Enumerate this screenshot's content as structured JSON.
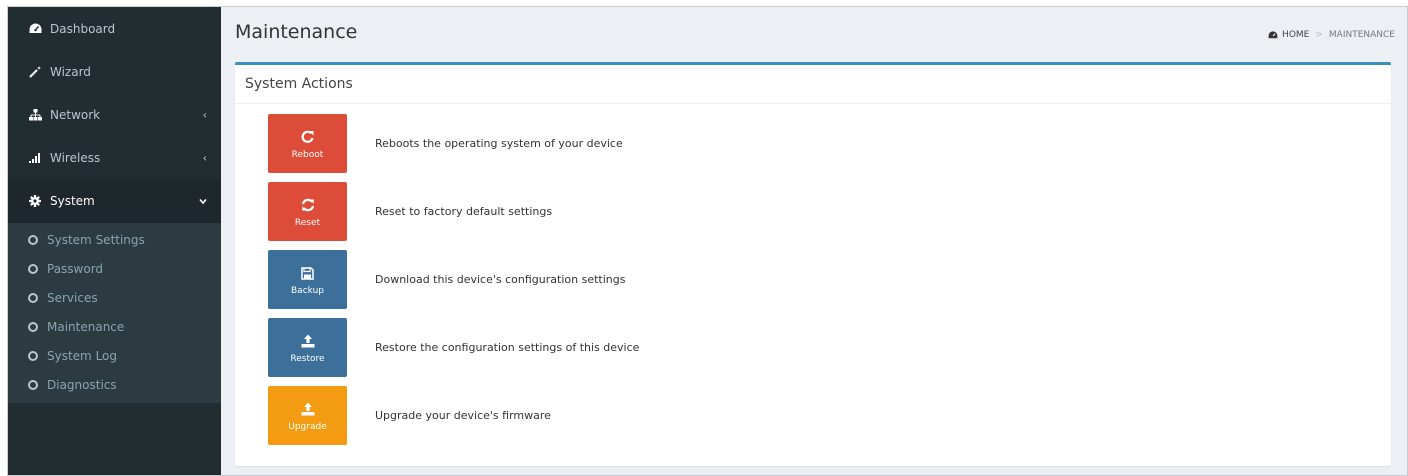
{
  "sidebar": {
    "items": [
      {
        "label": "Dashboard",
        "icon": "dashboard-icon"
      },
      {
        "label": "Wizard",
        "icon": "magic-wand-icon"
      },
      {
        "label": "Network",
        "icon": "sitemap-icon",
        "has_chevron": true
      },
      {
        "label": "Wireless",
        "icon": "signal-icon",
        "has_chevron": true
      },
      {
        "label": "System",
        "icon": "gear-icon",
        "has_chevron": true,
        "expanded": true
      }
    ],
    "submenu": [
      {
        "label": "System Settings"
      },
      {
        "label": "Password"
      },
      {
        "label": "Services"
      },
      {
        "label": "Maintenance"
      },
      {
        "label": "System Log"
      },
      {
        "label": "Diagnostics"
      }
    ]
  },
  "header": {
    "title": "Maintenance",
    "breadcrumb": {
      "home": "HOME",
      "current": "MAINTENANCE",
      "separator": ">"
    }
  },
  "panel": {
    "title": "System Actions",
    "actions": [
      {
        "label": "Reboot",
        "description": "Reboots the operating system of your device",
        "icon": "refresh-icon",
        "color": "#dd4b39"
      },
      {
        "label": "Reset",
        "description": "Reset to factory default settings",
        "icon": "sync-icon",
        "color": "#dd4b39"
      },
      {
        "label": "Backup",
        "description": "Download this device's configuration settings",
        "icon": "floppy-disk-icon",
        "color": "#3c6f9a"
      },
      {
        "label": "Restore",
        "description": "Restore the configuration settings of this device",
        "icon": "upload-icon",
        "color": "#3c6f9a"
      },
      {
        "label": "Upgrade",
        "description": "Upgrade your device's firmware",
        "icon": "upload-icon",
        "color": "#f39c12"
      }
    ]
  },
  "colors": {
    "sidebar_bg": "#222d32",
    "submenu_bg": "#2c3b41",
    "content_bg": "#ecf0f5",
    "accent": "#3c8dbc",
    "danger": "#dd4b39",
    "primary": "#3c6f9a",
    "warning": "#f39c12"
  }
}
